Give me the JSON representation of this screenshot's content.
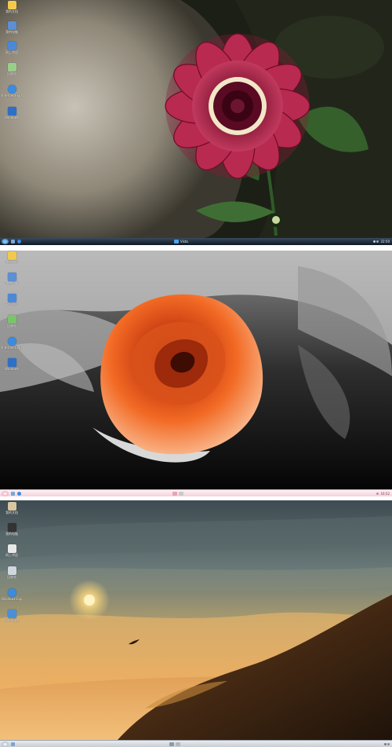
{
  "screens": [
    {
      "icons": [
        {
          "label": "我的文档",
          "icon": "folder-icon",
          "color": "#f2c94c"
        },
        {
          "label": "我的电脑",
          "icon": "computer-icon",
          "color": "#5b8fd6"
        },
        {
          "label": "网上邻居",
          "icon": "network-icon",
          "color": "#4a89d8"
        },
        {
          "label": "回收站",
          "icon": "recycle-bin-icon",
          "color": "#9acd8a"
        },
        {
          "label": "Internet Explorer",
          "icon": "ie-icon",
          "color": "#3b8be0"
        },
        {
          "label": "Windows",
          "icon": "media-player-icon",
          "color": "#2e6fc7"
        }
      ],
      "taskbar": {
        "label": "Vista",
        "clock": "22:50"
      }
    },
    {
      "icons": [
        {
          "label": "我的文档",
          "icon": "folder-icon",
          "color": "#f2c94c"
        },
        {
          "label": "我的电脑",
          "icon": "computer-icon",
          "color": "#5b8fd6"
        },
        {
          "label": "网上邻居",
          "icon": "network-icon",
          "color": "#4a89d8"
        },
        {
          "label": "回收站",
          "icon": "recycle-bin-icon",
          "color": "#7cc46a"
        },
        {
          "label": "Internet Explorer",
          "icon": "ie-icon",
          "color": "#3b8be0"
        },
        {
          "label": "Windows",
          "icon": "media-player-icon",
          "color": "#2e6fc7"
        }
      ],
      "taskbar": {
        "label": "",
        "clock": "16:52"
      }
    },
    {
      "icons": [
        {
          "label": "我的文档",
          "icon": "folder-icon",
          "color": "#d8c6a0"
        },
        {
          "label": "我的电脑",
          "icon": "computer-icon",
          "color": "#333333"
        },
        {
          "label": "网上邻居",
          "icon": "network-icon",
          "color": "#e8e8e8"
        },
        {
          "label": "回收站",
          "icon": "recycle-bin-icon",
          "color": "#cfd6dc"
        },
        {
          "label": "Windows Explorer",
          "icon": "ie-icon",
          "color": "#3b8be0"
        },
        {
          "label": "Windows",
          "icon": "media-player-icon",
          "color": "#4a90d9"
        }
      ],
      "taskbar": {
        "label": "",
        "clock": ""
      }
    }
  ]
}
